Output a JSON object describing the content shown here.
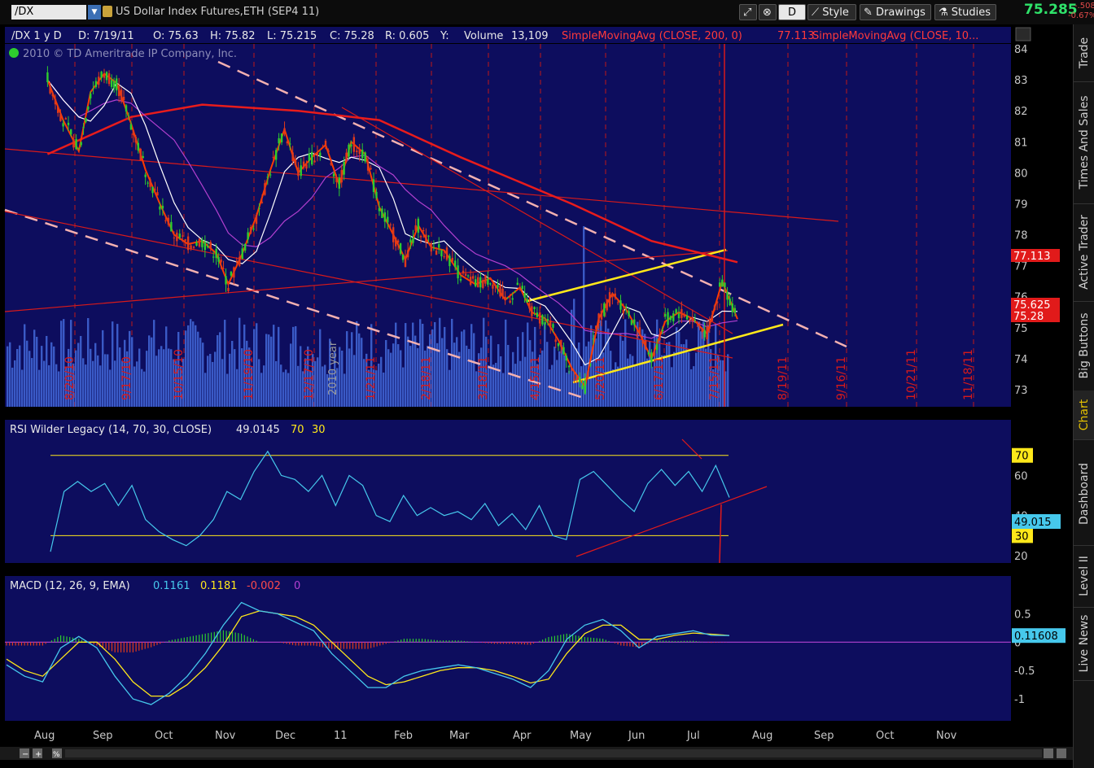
{
  "toolbar": {
    "symbol": "/DX",
    "description": "US Dollar Index Futures,ETH (SEP4 11)",
    "aggregation": "D",
    "style_label": "Style",
    "drawings_label": "Drawings",
    "studies_label": "Studies",
    "last_price": "75.285",
    "change_1": "-.508",
    "change_2": "-0.67%"
  },
  "side_tabs": [
    "Trade",
    "Times And Sales",
    "Active Trader",
    "Big Buttons",
    "Chart",
    "Dashboard",
    "Level II",
    "Live News"
  ],
  "header": {
    "symbol_period": "/DX 1 y D",
    "date": "D: 7/19/11",
    "open": "O: 75.63",
    "high": "H: 75.82",
    "low": "L: 75.215",
    "close": "C: 75.28",
    "range": "R: 0.605",
    "y_label": "Y:",
    "volume_label": "Volume",
    "volume": "13,109",
    "sma200_label": "SimpleMovingAvg (CLOSE, 200, 0)",
    "sma200_value": "77.113",
    "sma_other_label": "SimpleMovingAvg (CLOSE, 10...",
    "copyright": "2010 © TD Ameritrade IP Company, Inc."
  },
  "colors": {
    "panel_bg": "#0d0d5e",
    "up_candle": "#2ecc2e",
    "down_candle": "#e03a1a",
    "sma200": "#e81c1c",
    "sma50": "#b340d0",
    "sma20": "#ffffff",
    "sma_fast": "#ff3a00",
    "volume": "#3a5ac6",
    "channel": "#ffe81a",
    "rsi": "#46c8ec",
    "macd_signal": "#ffe81a",
    "macd_line": "#46c8ec",
    "trend": "#e11a1a"
  },
  "chart_data": [
    {
      "type": "candlestick",
      "title": "/DX 1 y D",
      "ylim": [
        72.5,
        84.2
      ],
      "yticks": [
        73,
        74,
        75,
        76,
        77,
        78,
        79,
        80,
        81,
        82,
        83,
        84
      ],
      "x_month_labels": [
        "Aug",
        "Sep",
        "Oct",
        "Nov",
        "Dec",
        "11",
        "Feb",
        "Mar",
        "Apr",
        "May",
        "Jun",
        "Jul",
        "Aug",
        "Sep",
        "Oct",
        "Nov"
      ],
      "expiration_labels": [
        "8/20/10",
        "9/17/10",
        "10/15/10",
        "11/19/10",
        "12/17/10",
        "1/21/11",
        "2/18/11",
        "3/18/11",
        "4/15/11",
        "5/20/11",
        "6/17/11",
        "7/15/11",
        "8/19/11",
        "9/16/11",
        "10/21/11",
        "11/18/11"
      ],
      "year_label": "2010 year",
      "price_labels": [
        {
          "text": "77.113",
          "value": 77.113
        },
        {
          "text": "75.625",
          "value": 75.625
        },
        {
          "text": "75.28",
          "value": 75.28
        }
      ],
      "close_path": [
        [
          "Aug 2",
          83.0
        ],
        [
          "Aug 10",
          81.7
        ],
        [
          "Aug 18",
          80.7
        ],
        [
          "Aug 24",
          82.6
        ],
        [
          "Aug 31",
          83.2
        ],
        [
          "Sep 7",
          82.9
        ],
        [
          "Sep 14",
          81.6
        ],
        [
          "Sep 21",
          80.1
        ],
        [
          "Sep 28",
          79.0
        ],
        [
          "Oct 5",
          78.0
        ],
        [
          "Oct 12",
          77.7
        ],
        [
          "Oct 19",
          77.8
        ],
        [
          "Oct 26",
          77.4
        ],
        [
          "Nov 2",
          76.4
        ],
        [
          "Nov 9",
          77.4
        ],
        [
          "Nov 16",
          78.6
        ],
        [
          "Nov 23",
          80.1
        ],
        [
          "Nov 30",
          81.4
        ],
        [
          "Dec 7",
          80.0
        ],
        [
          "Dec 14",
          80.5
        ],
        [
          "Dec 21",
          80.9
        ],
        [
          "Dec 28",
          79.6
        ],
        [
          "Jan 4",
          81.0
        ],
        [
          "Jan 11",
          80.6
        ],
        [
          "Jan 18",
          78.9
        ],
        [
          "Jan 25",
          78.0
        ],
        [
          "Feb 1",
          77.2
        ],
        [
          "Feb 8",
          78.3
        ],
        [
          "Feb 15",
          77.6
        ],
        [
          "Feb 22",
          77.5
        ],
        [
          "Mar 1",
          76.7
        ],
        [
          "Mar 8",
          76.4
        ],
        [
          "Mar 15",
          76.6
        ],
        [
          "Mar 22",
          75.9
        ],
        [
          "Mar 29",
          76.3
        ],
        [
          "Apr 5",
          75.5
        ],
        [
          "Apr 12",
          75.3
        ],
        [
          "Apr 19",
          74.6
        ],
        [
          "Apr 26",
          73.7
        ],
        [
          "May 3",
          73.1
        ],
        [
          "May 10",
          75.3
        ],
        [
          "May 17",
          76.1
        ],
        [
          "May 24",
          75.6
        ],
        [
          "May 31",
          74.8
        ],
        [
          "Jun 7",
          74.0
        ],
        [
          "Jun 14",
          75.2
        ],
        [
          "Jun 21",
          75.5
        ],
        [
          "Jun 28",
          75.3
        ],
        [
          "Jul 5",
          74.8
        ],
        [
          "Jul 12",
          76.5
        ],
        [
          "Jul 19",
          75.28
        ]
      ],
      "moving_averages": {
        "SMA 200 (77.113)": [
          [
            "Aug 2",
            80.6
          ],
          [
            "Sep 14",
            81.8
          ],
          [
            "Oct 19",
            82.2
          ],
          [
            "Dec 7",
            82.0
          ],
          [
            "Jan 18",
            81.7
          ],
          [
            "Mar 1",
            80.5
          ],
          [
            "Apr 26",
            79.0
          ],
          [
            "Jun 7",
            77.8
          ],
          [
            "Jul 19",
            77.113
          ]
        ]
      },
      "volume_panel": "lower portion of price pane"
    },
    {
      "type": "line",
      "title": "RSI Wilder Legacy (14, 70, 30, CLOSE)",
      "ylim": [
        18,
        78
      ],
      "yticks": [
        20,
        40,
        60
      ],
      "levels": [
        70,
        30
      ],
      "current_value": "49.015",
      "header_values": [
        "49.0145",
        "70",
        "30"
      ],
      "series": [
        {
          "name": "RSI",
          "values": [
            22,
            52,
            57,
            52,
            56,
            45,
            55,
            38,
            32,
            28,
            25,
            30,
            38,
            52,
            48,
            62,
            72,
            60,
            58,
            52,
            60,
            45,
            60,
            55,
            40,
            37,
            50,
            40,
            44,
            40,
            42,
            38,
            46,
            35,
            41,
            33,
            45,
            30,
            28,
            58,
            62,
            55,
            48,
            42,
            56,
            63,
            55,
            62,
            52,
            65,
            49
          ]
        }
      ]
    },
    {
      "type": "line",
      "title": "MACD (12, 26, 9, EMA)",
      "ylim": [
        -1.3,
        0.85
      ],
      "yticks": [
        0.5,
        0,
        -0.5,
        -1
      ],
      "current_value": "0.11608",
      "header_values": [
        "0.1161",
        "0.1181",
        "-0.002",
        "0"
      ],
      "series": [
        {
          "name": "Value",
          "values": [
            -0.4,
            -0.6,
            -0.7,
            -0.1,
            0.1,
            -0.1,
            -0.6,
            -1.0,
            -1.1,
            -0.9,
            -0.6,
            -0.2,
            0.3,
            0.7,
            0.55,
            0.5,
            0.35,
            0.2,
            -0.2,
            -0.5,
            -0.8,
            -0.8,
            -0.6,
            -0.5,
            -0.45,
            -0.4,
            -0.45,
            -0.55,
            -0.65,
            -0.8,
            -0.5,
            0.05,
            0.3,
            0.4,
            0.2,
            -0.1,
            0.1,
            0.15,
            0.2,
            0.12,
            0.116
          ]
        },
        {
          "name": "Avg",
          "values": [
            -0.3,
            -0.5,
            -0.6,
            -0.3,
            0.0,
            0.0,
            -0.3,
            -0.7,
            -0.95,
            -0.95,
            -0.75,
            -0.45,
            -0.05,
            0.45,
            0.55,
            0.5,
            0.45,
            0.3,
            0.0,
            -0.3,
            -0.6,
            -0.75,
            -0.7,
            -0.6,
            -0.5,
            -0.45,
            -0.45,
            -0.5,
            -0.6,
            -0.72,
            -0.65,
            -0.2,
            0.15,
            0.3,
            0.3,
            0.05,
            0.05,
            0.12,
            0.16,
            0.14,
            0.118
          ]
        }
      ]
    }
  ],
  "footer": {
    "zoom_out": "−",
    "zoom_in": "+",
    "zoom_box": "⊕",
    "percent": "%"
  }
}
